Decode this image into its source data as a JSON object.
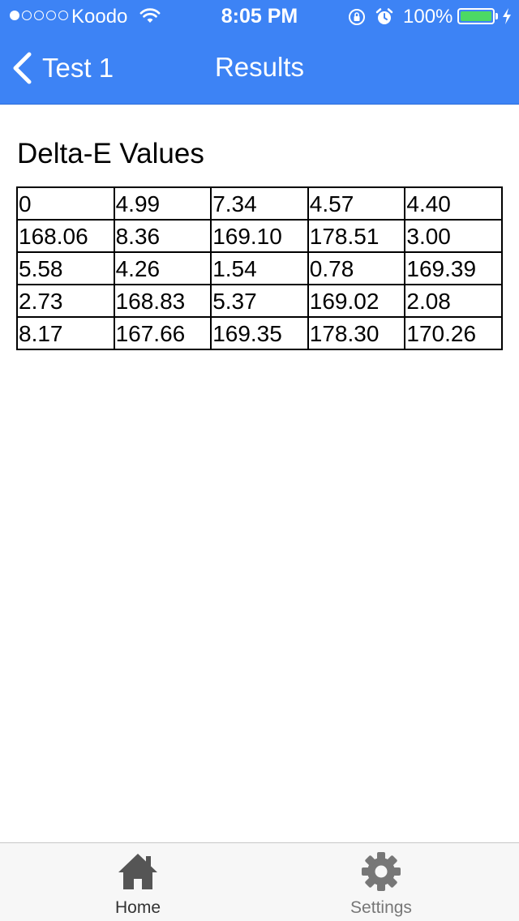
{
  "status_bar": {
    "carrier": "Koodo",
    "time": "8:05 PM",
    "battery_percent": "100%",
    "battery_level": 1.0,
    "signal_bars_filled": 1,
    "signal_bars_total": 5
  },
  "nav": {
    "back_label": "Test 1",
    "title": "Results"
  },
  "section": {
    "title": "Delta-E Values"
  },
  "table": {
    "rows": [
      [
        "0",
        "4.99",
        "7.34",
        "4.57",
        "4.40"
      ],
      [
        "168.06",
        "8.36",
        "169.10",
        "178.51",
        "3.00"
      ],
      [
        "5.58",
        "4.26",
        "1.54",
        "0.78",
        "169.39"
      ],
      [
        "2.73",
        "168.83",
        "5.37",
        "169.02",
        "2.08"
      ],
      [
        "8.17",
        "167.66",
        "169.35",
        "178.30",
        "170.26"
      ]
    ]
  },
  "tabs": [
    {
      "label": "Home",
      "icon": "home-icon",
      "active": true
    },
    {
      "label": "Settings",
      "icon": "gear-icon",
      "active": false
    }
  ],
  "colors": {
    "header_bg": "#3d83f5",
    "battery_fill": "#4cd964",
    "tab_active": "#333333",
    "tab_inactive": "#777777"
  }
}
